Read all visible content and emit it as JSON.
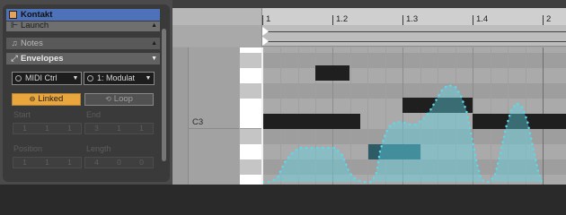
{
  "clip": {
    "title": "Kontakt",
    "title_color": "#4d72ba",
    "clip_color": "#e3a35a"
  },
  "sections": {
    "launch": "Launch",
    "notes": "Notes",
    "envelopes": "Envelopes",
    "launch_icon": "launch-icon",
    "notes_icon": "music-note-icon",
    "envelopes_icon": "envelope-icon",
    "collapse_arrow": "▲",
    "expand_arrow": "▼"
  },
  "envelopes": {
    "device": "MIDI Ctrl",
    "control": "1: Modulat",
    "linked_label": "Linked",
    "loop_label": "Loop",
    "linked_active": true,
    "start_label": "Start",
    "end_label": "End",
    "position_label": "Position",
    "length_label": "Length",
    "start_value": [
      "1",
      "1",
      "1"
    ],
    "end_value": [
      "3",
      "1",
      "1"
    ],
    "position_value": [
      "1",
      "1",
      "1"
    ],
    "length_value": [
      "4",
      "0",
      "0"
    ]
  },
  "ruler": {
    "markers": [
      "1",
      "1.2",
      "1.3",
      "1.4",
      "2"
    ]
  },
  "piano": {
    "note_label": "C3"
  },
  "colors": {
    "envelope_line": "#5fd7ea",
    "envelope_fill": "#5fd7ea",
    "linked_active": "#e9a63d",
    "note": "#1f1f1f"
  }
}
